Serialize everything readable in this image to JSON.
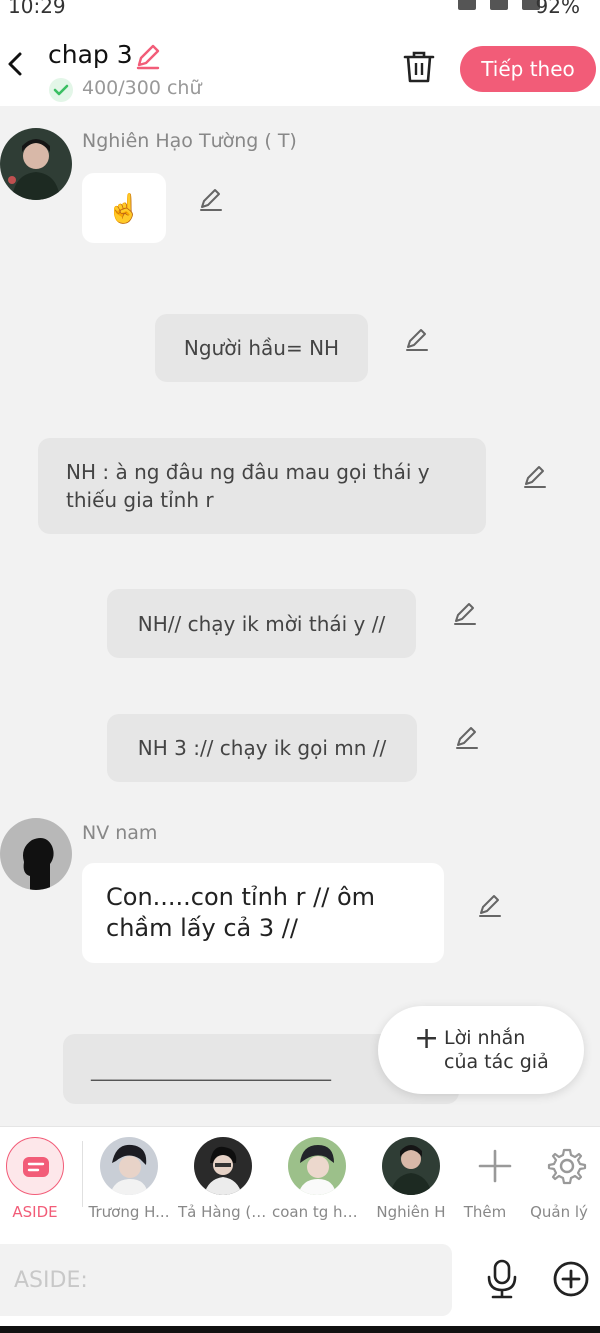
{
  "status_bar": {
    "time": "10:29",
    "battery": "92%"
  },
  "header": {
    "title": "chap 3",
    "word_count": "400/300 chữ",
    "next_label": "Tiếp theo",
    "accent_color": "#f25c78"
  },
  "messages": [
    {
      "speaker": "Nghiên Hạo Tường ( T)",
      "text": "☝️",
      "style": "white"
    },
    {
      "speaker": "",
      "text": "Người hầu= NH",
      "style": "grey"
    },
    {
      "speaker": "",
      "text": "NH : à ng đâu ng đâu mau gọi thái y thiếu gia tỉnh r",
      "style": "grey"
    },
    {
      "speaker": "",
      "text": "NH// chạy ik mời thái y //",
      "style": "grey"
    },
    {
      "speaker": "",
      "text": "NH 3 :// chạy ik gọi mn //",
      "style": "grey"
    },
    {
      "speaker": "NV nam",
      "text": "Con.....con tỉnh r // ôm chầm lấy cả 3 //",
      "style": "white"
    }
  ],
  "partial_bubble_text": "________________________",
  "author_note": {
    "label_line1": "Lời nhắn",
    "label_line2": "của tác giả"
  },
  "characters": [
    {
      "label": "ASIDE",
      "active": true
    },
    {
      "label": "Trương H..."
    },
    {
      "label": "Tả Hàng ( ..."
    },
    {
      "label": "coan tg ha..."
    },
    {
      "label": "Nghiên H"
    },
    {
      "label": "Thêm"
    },
    {
      "label": "Quản lý"
    }
  ],
  "input": {
    "placeholder": "ASIDE:"
  }
}
